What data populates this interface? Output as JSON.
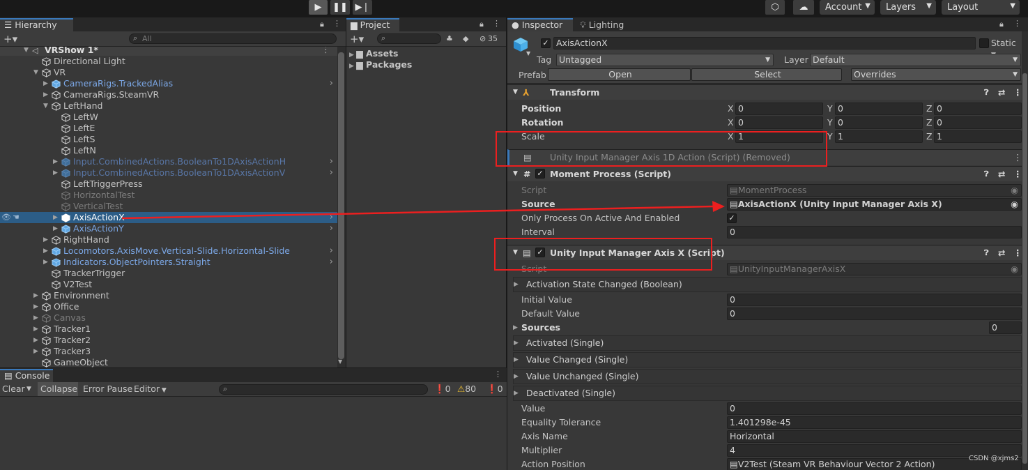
{
  "toolbar": {
    "play_icon": "play-icon",
    "pause_icon": "pause-icon",
    "step_icon": "step-icon",
    "account_label": "Account",
    "layers_label": "Layers",
    "layout_label": "Layout"
  },
  "hierarchy": {
    "tab_label": "Hierarchy",
    "search_placeholder": "All",
    "scene_name": "VRShow 1*",
    "items": [
      {
        "label": "Directional Light"
      },
      {
        "label": "VR"
      },
      {
        "label": "CameraRigs.TrackedAlias"
      },
      {
        "label": "CameraRigs.SteamVR"
      },
      {
        "label": "LeftHand"
      },
      {
        "label": "LeftW"
      },
      {
        "label": "LeftE"
      },
      {
        "label": "LeftS"
      },
      {
        "label": "LeftN"
      },
      {
        "label": "Input.CombinedActions.BooleanTo1DAxisActionH"
      },
      {
        "label": "Input.CombinedActions.BooleanTo1DAxisActionV"
      },
      {
        "label": "LeftTriggerPress"
      },
      {
        "label": "HorizontalTest"
      },
      {
        "label": "VerticalTest"
      },
      {
        "label": "AxisActionX"
      },
      {
        "label": "AxisActionY"
      },
      {
        "label": "RightHand"
      },
      {
        "label": "Locomotors.AxisMove.Vertical-Slide.Horizontal-Slide"
      },
      {
        "label": "Indicators.ObjectPointers.Straight"
      },
      {
        "label": "TrackerTrigger"
      },
      {
        "label": "V2Test"
      },
      {
        "label": "Environment"
      },
      {
        "label": "Office"
      },
      {
        "label": "Canvas"
      },
      {
        "label": "Tracker1"
      },
      {
        "label": "Tracker2"
      },
      {
        "label": "Tracker3"
      },
      {
        "label": "GameObject"
      }
    ]
  },
  "project": {
    "tab_label": "Project",
    "hidden_count": "35",
    "folders": [
      "Assets",
      "Packages"
    ]
  },
  "console": {
    "tab_label": "Console",
    "clear": "Clear",
    "collapse": "Collapse",
    "error_pause": "Error Pause",
    "editor": "Editor",
    "count_log": "0",
    "count_warn": "80",
    "count_error": "0"
  },
  "inspector": {
    "tab_label": "Inspector",
    "lighting_tab": "Lighting",
    "object_name": "AxisActionX",
    "static_label": "Static",
    "tag_label": "Tag",
    "tag_value": "Untagged",
    "layer_label": "Layer",
    "layer_value": "Default",
    "prefab_label": "Prefab",
    "open_label": "Open",
    "select_label": "Select",
    "overrides_label": "Overrides",
    "transform": {
      "title": "Transform",
      "position_label": "Position",
      "rotation_label": "Rotation",
      "scale_label": "Scale",
      "x": "X",
      "y": "Y",
      "z": "Z",
      "position": [
        "0",
        "0",
        "0"
      ],
      "rotation": [
        "0",
        "0",
        "0"
      ],
      "scale": [
        "1",
        "1",
        "1"
      ]
    },
    "removed_component": "Unity Input Manager Axis 1D Action (Script) (Removed)",
    "moment_process": {
      "title": "Moment Process (Script)",
      "script_label": "Script",
      "script_value": "MomentProcess",
      "source_label": "Source",
      "source_value": "AxisActionX (Unity Input Manager Axis X)",
      "only_process_label": "Only Process On Active And Enabled",
      "interval_label": "Interval",
      "interval_value": "0"
    },
    "axis_x": {
      "title": "Unity Input Manager Axis X (Script)",
      "script_label": "Script",
      "script_value": "UnityInputManagerAxisX",
      "activation_state_changed": "Activation State Changed (Boolean)",
      "initial_value_label": "Initial Value",
      "initial_value": "0",
      "default_value_label": "Default Value",
      "default_value": "0",
      "sources_label": "Sources",
      "sources_count": "0",
      "activated": "Activated (Single)",
      "value_changed": "Value Changed (Single)",
      "value_unchanged": "Value Unchanged (Single)",
      "deactivated": "Deactivated (Single)",
      "value_label": "Value",
      "value": "0",
      "equality_tolerance_label": "Equality Tolerance",
      "equality_tolerance": "1.401298e-45",
      "axis_name_label": "Axis Name",
      "axis_name": "Horizontal",
      "multiplier_label": "Multiplier",
      "multiplier": "4",
      "action_position_label": "Action Position",
      "action_position": "V2Test (Steam VR Behaviour Vector 2 Action)"
    }
  },
  "watermark": "CSDN @xjms2",
  "colors": {
    "accent_blue": "#3a79bb",
    "selection": "#2c5d87",
    "annotation_red": "#ec1f1f",
    "prefab_blue": "#7ba7e6"
  }
}
